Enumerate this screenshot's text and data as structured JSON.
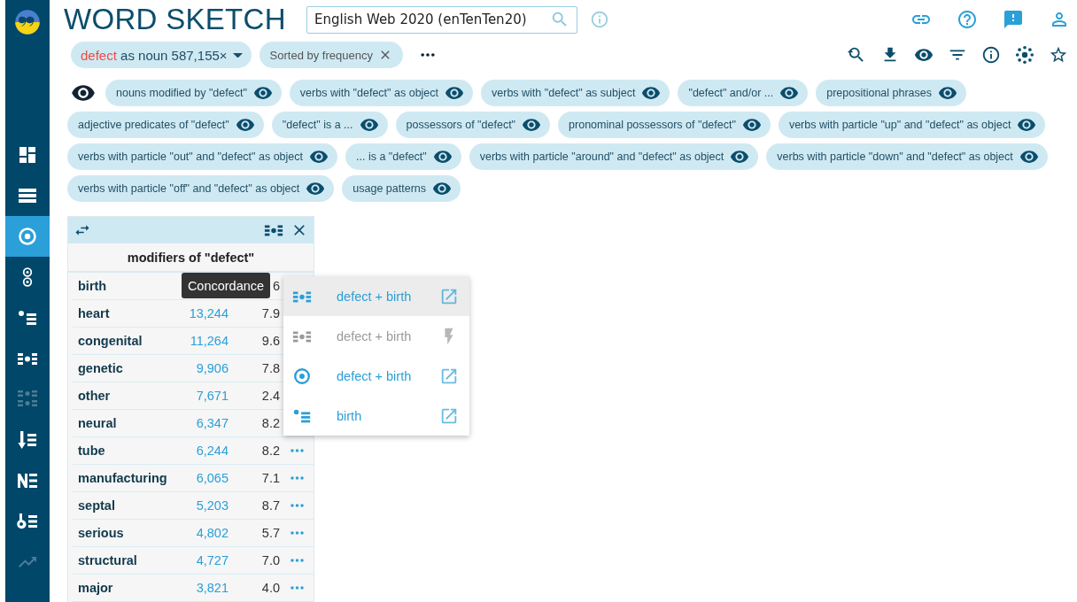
{
  "app": {
    "title": "WORD SKETCH"
  },
  "corpus_search": {
    "value": "English Web 2020 (enTenTen20)"
  },
  "sidebar": {
    "items": [
      {
        "kind": "dashboard",
        "selected": false,
        "disabled": false
      },
      {
        "kind": "corpus-list",
        "selected": false,
        "disabled": false
      },
      {
        "kind": "word-sketch",
        "selected": true,
        "disabled": false
      },
      {
        "kind": "sketch-diff",
        "selected": false,
        "disabled": false
      },
      {
        "kind": "thesaurus",
        "selected": false,
        "disabled": false
      },
      {
        "kind": "concordance",
        "selected": false,
        "disabled": false
      },
      {
        "kind": "parallel-concordance",
        "selected": false,
        "disabled": true
      },
      {
        "kind": "wordlist",
        "selected": false,
        "disabled": false
      },
      {
        "kind": "ngrams",
        "selected": false,
        "disabled": false
      },
      {
        "kind": "keywords",
        "selected": false,
        "disabled": false
      },
      {
        "kind": "trends",
        "selected": false,
        "disabled": true
      }
    ]
  },
  "query_chip": {
    "lemma": "defect",
    "rest": "as noun 587,155×"
  },
  "sort_chip": {
    "label": "Sorted by frequency"
  },
  "relations": [
    {
      "label": "nouns modified by \"defect\""
    },
    {
      "label": "verbs with \"defect\" as object"
    },
    {
      "label": "verbs with \"defect\" as subject"
    },
    {
      "label": "\"defect\" and/or ..."
    },
    {
      "label": "prepositional phrases"
    },
    {
      "label": "adjective predicates of \"defect\""
    },
    {
      "label": "\"defect\" is a ..."
    },
    {
      "label": "possessors of \"defect\""
    },
    {
      "label": "pronominal possessors of \"defect\""
    },
    {
      "label": "verbs with particle \"up\" and \"defect\" as object"
    },
    {
      "label": "verbs with particle \"out\" and \"defect\" as object"
    },
    {
      "label": "... is a \"defect\""
    },
    {
      "label": "verbs with particle \"around\" and \"defect\" as object"
    },
    {
      "label": "verbs with particle \"down\" and \"defect\" as object"
    },
    {
      "label": "verbs with particle \"off\" and \"defect\" as object"
    },
    {
      "label": "usage patterns"
    }
  ],
  "panel": {
    "title": "modifiers of \"defect\"",
    "rows": [
      {
        "word": "birth",
        "score": "6",
        "more_button": false
      },
      {
        "word": "heart",
        "frequency": "13,244",
        "score": "7.9",
        "more_button": false
      },
      {
        "word": "congenital",
        "frequency": "11,264",
        "score": "9.6",
        "more_button": false
      },
      {
        "word": "genetic",
        "frequency": "9,906",
        "score": "7.8",
        "more_button": false
      },
      {
        "word": "other",
        "frequency": "7,671",
        "score": "2.4",
        "more_button": false
      },
      {
        "word": "neural",
        "frequency": "6,347",
        "score": "8.2",
        "more_button": false
      },
      {
        "word": "tube",
        "frequency": "6,244",
        "score": "8.2",
        "more_button": true
      },
      {
        "word": "manufacturing",
        "frequency": "6,065",
        "score": "7.1",
        "more_button": true
      },
      {
        "word": "septal",
        "frequency": "5,203",
        "score": "8.7",
        "more_button": true
      },
      {
        "word": "serious",
        "frequency": "4,802",
        "score": "5.7",
        "more_button": true
      },
      {
        "word": "structural",
        "frequency": "4,727",
        "score": "7.0",
        "more_button": true
      },
      {
        "word": "major",
        "frequency": "3,821",
        "score": "4.0",
        "more_button": true
      }
    ]
  },
  "tooltip": {
    "text": "Concordance"
  },
  "context_menu": {
    "items": [
      {
        "kind": "concordance",
        "label": "defect + birth",
        "selected": true,
        "disabled": false
      },
      {
        "kind": "quick-concordance",
        "label": "defect + birth",
        "selected": false,
        "disabled": true
      },
      {
        "kind": "word-sketch",
        "label": "defect + birth",
        "selected": false,
        "disabled": false
      },
      {
        "kind": "thesaurus",
        "label": "birth",
        "selected": false,
        "disabled": false
      }
    ]
  }
}
